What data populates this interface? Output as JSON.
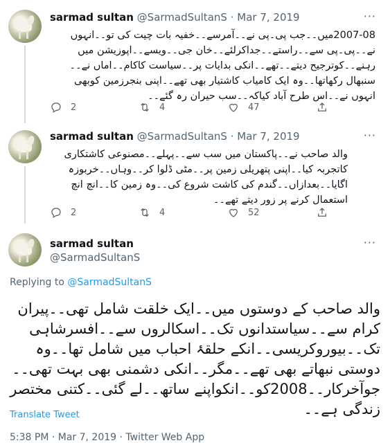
{
  "tweets": [
    {
      "name": "sarmad sultan",
      "handle": "@SarmadSultanS",
      "sep": "·",
      "date": "Mar 7, 2019",
      "text": "2007-08میں۔۔جب پی۔پی نے۔۔آمرسے۔۔خفیہ بات چیت کی تو۔۔انہوں نے۔۔پی۔پی سے۔۔راستے۔۔جداکرلئے۔۔خان جی۔۔ویسے۔۔اپوزیشن میں رہنے۔۔کوترجیح دیتے۔۔تھے۔۔انکی بدایات پر۔۔سیاست کاکام۔۔اماں نے۔۔سنبھال رکھاتھا۔۔وہ ایک کامیاب کاشتیار بھی تھے۔۔اپنی بنجرزمین کوبھی انہوں نے۔۔اس طرح آباد کیاکہ۔۔سب حیران رہ گئے۔۔",
      "replies": "2",
      "retweets": "4",
      "likes": "47"
    },
    {
      "name": "sarmad sultan",
      "handle": "@SarmadSultanS",
      "sep": "·",
      "date": "Mar 7, 2019",
      "text": "والد صاحب نے۔۔پاکستان میں سب سے۔۔پہلے۔۔مصنوعی کاشتکاری کاتجربہ کیا۔۔اپنی پتھریلی زمین پر۔۔مٹی ڈلوا کر۔۔وہاں۔۔خربوزہ اگایا۔۔بعدازاں۔۔گندم کی کاشت شروع کی۔۔وہ زمین کا۔۔انچ انچ استعمال کرنے پر زور دیتے تھے۔۔",
      "replies": "2",
      "retweets": "4",
      "likes": "52"
    }
  ],
  "main": {
    "name": "sarmad sultan",
    "handle": "@SarmadSultanS",
    "replying_prefix": "Replying to ",
    "replying_to": "@SarmadSultanS",
    "text": "والد صاحب کے دوستوں میں۔۔ایک خلقت شامل تھی۔۔پیران کرام سے۔۔سیاستدانوں تک۔۔اسکالروں سے۔۔افسرشاہی تک۔۔بیوروکریسی۔۔انکے حلقۂ احباب میں شامل تھا۔۔وہ دوستی نبھاتے بھی تھے۔۔مگر۔۔انکی دشمنی بھی بہت تھی۔۔جوآخرکار۔۔2008کو۔۔انکواپنے ساتھ۔۔لے گئی۔۔کتنی مختصر زندگی ہے۔۔",
    "translate": "Translate Tweet",
    "meta": "5:38 PM · Mar 7, 2019 · Twitter Web App"
  },
  "icons": [
    "reply-icon",
    "retweet-icon",
    "like-icon",
    "share-icon",
    "more-icon"
  ],
  "colors": {
    "link": "#1d9bf0",
    "muted": "#536471",
    "text": "#0f1419"
  }
}
